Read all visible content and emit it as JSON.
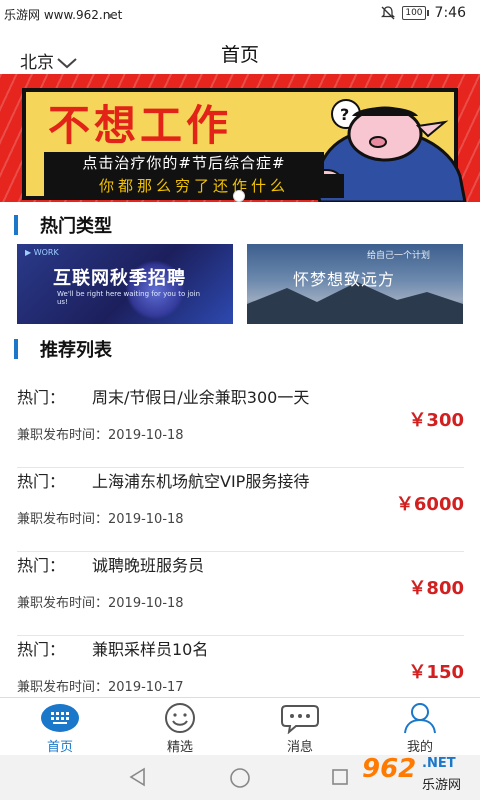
{
  "status_bar": {
    "watermark": "乐游网 www.962.net",
    "battery": "100",
    "time": "7:46"
  },
  "header": {
    "city": "北京",
    "title": "首页"
  },
  "banner": {
    "headline": "不想工作",
    "subline": "点击治疗你的#节后综合症#",
    "bottomline": "你都那么穷了还作什么"
  },
  "sections": {
    "hot_types": "热门类型",
    "recommend": "推荐列表"
  },
  "categories": [
    {
      "title": "互联网秋季招聘",
      "tag": "▶ WORK",
      "subtitle": "We'll be right here waiting for you to join us!"
    },
    {
      "title": "怀梦想致远方",
      "tag": "给自己一个计划"
    }
  ],
  "list": [
    {
      "label": "热门：",
      "job": "周末/节假日/业余兼职300一天",
      "date": "兼职发布时间：2019-10-18",
      "price": "￥300"
    },
    {
      "label": "热门：",
      "job": "上海浦东机场航空VIP服务接待",
      "date": "兼职发布时间：2019-10-18",
      "price": "￥6000"
    },
    {
      "label": "热门：",
      "job": "诚聘晚班服务员",
      "date": "兼职发布时间：2019-10-18",
      "price": "￥800"
    },
    {
      "label": "热门：",
      "job": "兼职采样员10名",
      "date": "兼职发布时间：2019-10-17",
      "price": "￥150"
    }
  ],
  "tabs": [
    {
      "label": "首页",
      "icon": "home-grid-icon"
    },
    {
      "label": "精选",
      "icon": "smile-icon"
    },
    {
      "label": "消息",
      "icon": "chat-bubble-icon"
    },
    {
      "label": "我的",
      "icon": "person-icon"
    }
  ],
  "watermark_bottom": {
    "num": "962",
    "net": ".NET",
    "site": "乐游网"
  },
  "colors": {
    "accent": "#1a77c9",
    "price": "#d21f1f",
    "banner_red": "#e6251f",
    "banner_yellow": "#f6d65a"
  }
}
